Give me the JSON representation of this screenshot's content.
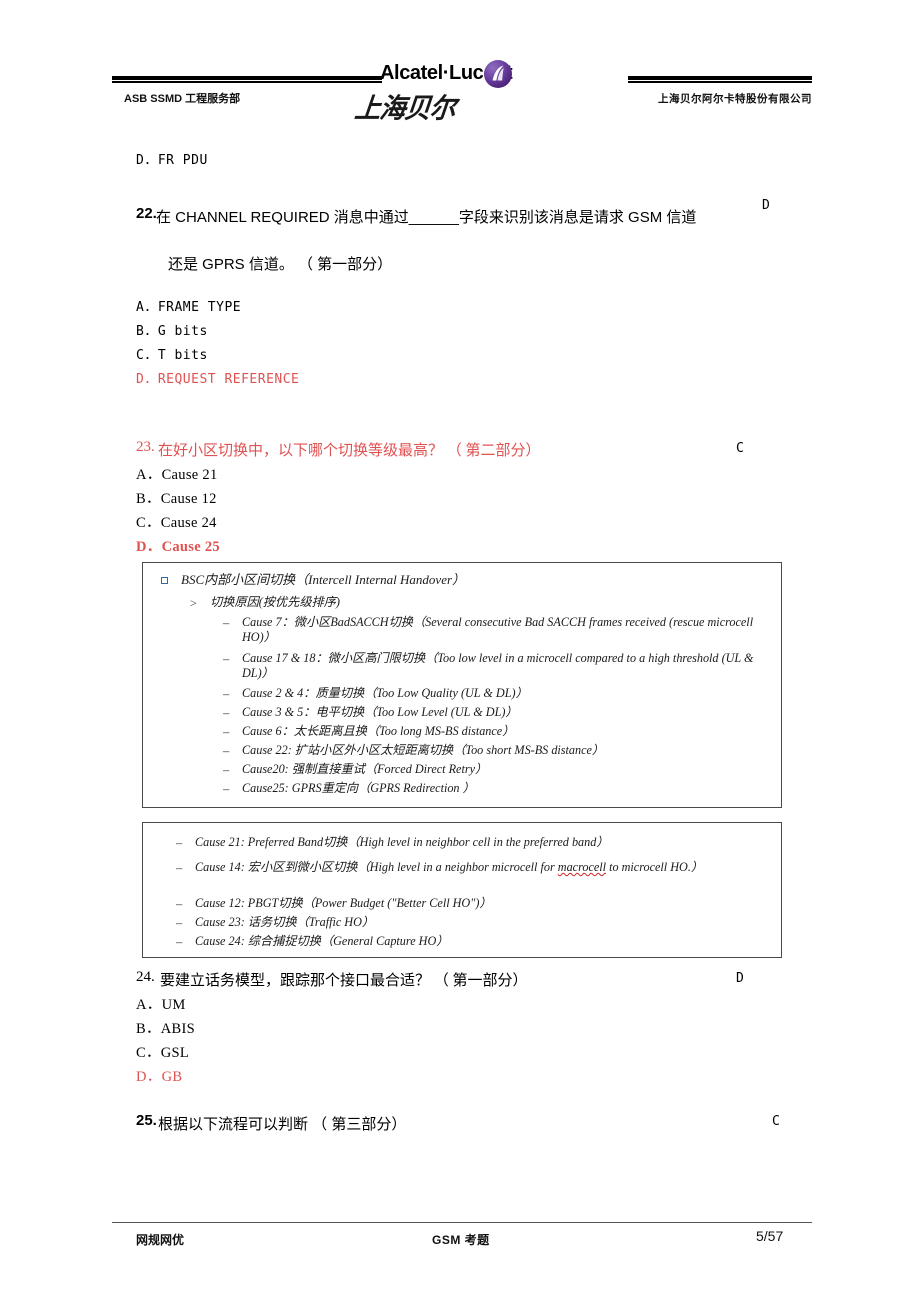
{
  "header": {
    "left_dept": "ASB SSMD 工程服务部",
    "brand_wordmark": "Alcatel·Lucent",
    "brand_logo_icon": "alcatel-lucent-circle-logo",
    "calligraphy": "上海贝尔",
    "right_company": "上海贝尔阿尔卡特股份有限公司"
  },
  "colors": {
    "answer_red": "#e05252",
    "brand_purple": "#6b3fa0",
    "spellcheck_red": "#cc2222",
    "bullet_blue": "#2b6ca3"
  },
  "content": {
    "orphan_option": "D．FR PDU",
    "questions": [
      {
        "number": "22.",
        "stem_line1": "在 CHANNEL REQUIRED 消息中通过______字段来识别该消息是请求 GSM 信道",
        "stem_line2": "还是 GPRS 信道。 （ 第一部分）",
        "answer_key": "D",
        "options": [
          {
            "label": "A．FRAME TYPE",
            "red": false
          },
          {
            "label": "B．G bits",
            "red": false
          },
          {
            "label": "C．T bits",
            "red": false
          },
          {
            "label": "D．REQUEST REFERENCE",
            "red": true
          }
        ]
      },
      {
        "number": "23.",
        "stem_line1": "在好小区切换中，以下哪个切换等级最高？ （ 第二部分）",
        "stem_red": true,
        "answer_key": "C",
        "options": [
          {
            "label": "A．Cause 21",
            "red": false
          },
          {
            "label": "B．Cause 12",
            "red": false
          },
          {
            "label": "C．Cause 24",
            "red": false
          },
          {
            "label": "D．Cause 25",
            "red": true
          }
        ]
      },
      {
        "number": "24.",
        "stem_line1": "要建立话务模型，跟踪那个接口最合适？ （ 第一部分）",
        "stem_red": false,
        "answer_key": "D",
        "options": [
          {
            "label": "A．UM",
            "red": false
          },
          {
            "label": "B．ABIS",
            "red": false
          },
          {
            "label": "C．GSL",
            "red": false
          },
          {
            "label": "D．GB",
            "red": true
          }
        ]
      },
      {
        "number": "25.",
        "stem_line1": "根据以下流程可以判断 （ 第三部分）",
        "answer_key": "C",
        "options": []
      }
    ],
    "slide_box_1": {
      "heading": "BSC内部小区间切换（Intercell Internal Handover）",
      "subheading": "切换原因(按优先级排序)",
      "items": [
        "Cause 7：微小区BadSACCH切换（Several consecutive Bad SACCH frames received (rescue microcell HO)）",
        "Cause 17 & 18：微小区高门限切换（Too low level in a microcell compared to a high threshold (UL & DL)）",
        "Cause 2 & 4：质量切换（Too Low Quality (UL & DL)）",
        "Cause 3 & 5：电平切换（Too Low Level (UL & DL)）",
        "Cause 6：太长距离且换（Too long MS-BS distance）",
        "Cause 22: 扩站小区外小区太短距离切换（Too short MS-BS distance）",
        "Cause20: 强制直接重试（Forced Direct Retry）",
        "Cause25: GPRS重定向（GPRS Redirection ）"
      ]
    },
    "slide_box_2": {
      "items": [
        "Cause 21: Preferred Band切换（High level in neighbor cell in the preferred  band）",
        "Cause 14: 宏小区到微小区切换（High level in a neighbor microcell for macrocell to microcell HO.）",
        "Cause 12: PBGT切换（Power Budget (\"Better Cell HO\")）",
        "Cause 23: 话务切换（Traffic HO）",
        "Cause 24: 综合捕捉切换（General Capture HO）"
      ],
      "spellcheck_word": "macrocell"
    }
  },
  "footer": {
    "left": "网规网优",
    "center": "GSM 考题",
    "page": "5/57"
  }
}
